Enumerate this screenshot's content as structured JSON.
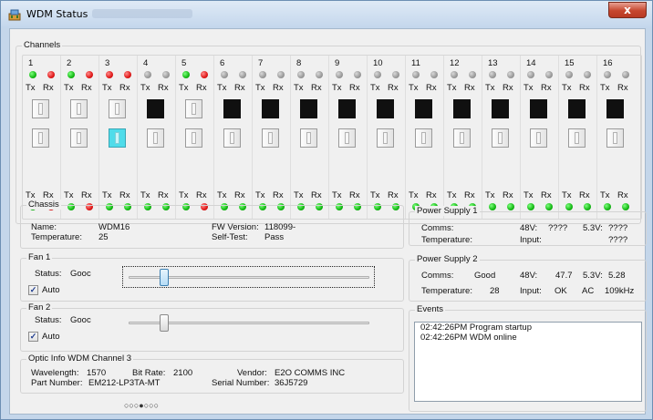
{
  "window": {
    "title": "WDM Status",
    "close_symbol": "x"
  },
  "channels": {
    "label": "Channels",
    "tx_label": "Tx",
    "rx_label": "Rx",
    "items": [
      {
        "num": "1",
        "top_tx": "green",
        "top_rx": "red",
        "port1": "empty",
        "port2": "empty",
        "bot_tx": "green",
        "bot_rx": "red"
      },
      {
        "num": "2",
        "top_tx": "green",
        "top_rx": "red",
        "port1": "empty",
        "port2": "empty",
        "bot_tx": "green",
        "bot_rx": "red"
      },
      {
        "num": "3",
        "top_tx": "red",
        "top_rx": "red",
        "port1": "empty",
        "port2": "cyan",
        "bot_tx": "green",
        "bot_rx": "green"
      },
      {
        "num": "4",
        "top_tx": "gray",
        "top_rx": "gray",
        "port1": "filled",
        "port2": "empty",
        "bot_tx": "green",
        "bot_rx": "green"
      },
      {
        "num": "5",
        "top_tx": "green",
        "top_rx": "red",
        "port1": "empty",
        "port2": "empty",
        "bot_tx": "green",
        "bot_rx": "red"
      },
      {
        "num": "6",
        "top_tx": "gray",
        "top_rx": "gray",
        "port1": "filled",
        "port2": "empty",
        "bot_tx": "green",
        "bot_rx": "green"
      },
      {
        "num": "7",
        "top_tx": "gray",
        "top_rx": "gray",
        "port1": "filled",
        "port2": "empty",
        "bot_tx": "green",
        "bot_rx": "green"
      },
      {
        "num": "8",
        "top_tx": "gray",
        "top_rx": "gray",
        "port1": "filled",
        "port2": "empty",
        "bot_tx": "green",
        "bot_rx": "green"
      },
      {
        "num": "9",
        "top_tx": "gray",
        "top_rx": "gray",
        "port1": "filled",
        "port2": "empty",
        "bot_tx": "green",
        "bot_rx": "green"
      },
      {
        "num": "10",
        "top_tx": "gray",
        "top_rx": "gray",
        "port1": "filled",
        "port2": "empty",
        "bot_tx": "green",
        "bot_rx": "green"
      },
      {
        "num": "11",
        "top_tx": "gray",
        "top_rx": "gray",
        "port1": "filled",
        "port2": "empty",
        "bot_tx": "green",
        "bot_rx": "green"
      },
      {
        "num": "12",
        "top_tx": "gray",
        "top_rx": "gray",
        "port1": "filled",
        "port2": "empty",
        "bot_tx": "green",
        "bot_rx": "green"
      },
      {
        "num": "13",
        "top_tx": "gray",
        "top_rx": "gray",
        "port1": "filled",
        "port2": "empty",
        "bot_tx": "green",
        "bot_rx": "green"
      },
      {
        "num": "14",
        "top_tx": "gray",
        "top_rx": "gray",
        "port1": "filled",
        "port2": "empty",
        "bot_tx": "green",
        "bot_rx": "green"
      },
      {
        "num": "15",
        "top_tx": "gray",
        "top_rx": "gray",
        "port1": "filled",
        "port2": "empty",
        "bot_tx": "green",
        "bot_rx": "green"
      },
      {
        "num": "16",
        "top_tx": "gray",
        "top_rx": "gray",
        "port1": "filled",
        "port2": "empty",
        "bot_tx": "green",
        "bot_rx": "green"
      }
    ]
  },
  "chassis": {
    "label": "Chassis",
    "name_label": "Name:",
    "name_value": "WDM16",
    "temp_label": "Temperature:",
    "temp_value": "25",
    "fw_label": "FW Version:",
    "fw_value": "118099-",
    "selftest_label": "Self-Test:",
    "selftest_value": "Pass"
  },
  "power_supply_1": {
    "label": "Power Supply 1",
    "comms_label": "Comms:",
    "temp_label": "Temperature:",
    "v48_label": "48V:",
    "v48_value": "????",
    "v53_label": "5.3V:",
    "v53_value": "????",
    "input_label": "Input:",
    "input_value": "????"
  },
  "power_supply_2": {
    "label": "Power Supply 2",
    "comms_label": "Comms:",
    "comms_value": "Good",
    "temp_label": "Temperature:",
    "temp_value": "28",
    "v48_label": "48V:",
    "v48_value": "47.7",
    "v53_label": "5.3V:",
    "v53_value": "5.28",
    "input_label": "Input:",
    "input_value": "OK",
    "input_type": "AC",
    "input_freq": "109kHz"
  },
  "fan1": {
    "label": "Fan 1",
    "status_label": "Status:",
    "status_value": "Gooc",
    "auto_label": "Auto",
    "auto_checked": "✓",
    "speed_fraction": 0.13
  },
  "fan2": {
    "label": "Fan 2",
    "status_label": "Status:",
    "status_value": "Gooc",
    "auto_label": "Auto",
    "auto_checked": "✓",
    "speed_fraction": 0.13
  },
  "optic": {
    "label": "Optic Info WDM Channel 3",
    "wavelength_label": "Wavelength:",
    "wavelength_value": "1570",
    "bitrate_label": "Bit Rate:",
    "bitrate_value": "2100",
    "vendor_label": "Vendor:",
    "vendor_value": "E2O COMMS INC",
    "part_label": "Part Number:",
    "part_value": "EM212-LP3TA-MT",
    "serial_label": "Serial Number:",
    "serial_value": "36J5729"
  },
  "events": {
    "label": "Events",
    "items": [
      "02:42:26PM Program startup",
      "02:42:26PM WDM online"
    ]
  },
  "pager": {
    "indicator": "○○○●○○○"
  }
}
